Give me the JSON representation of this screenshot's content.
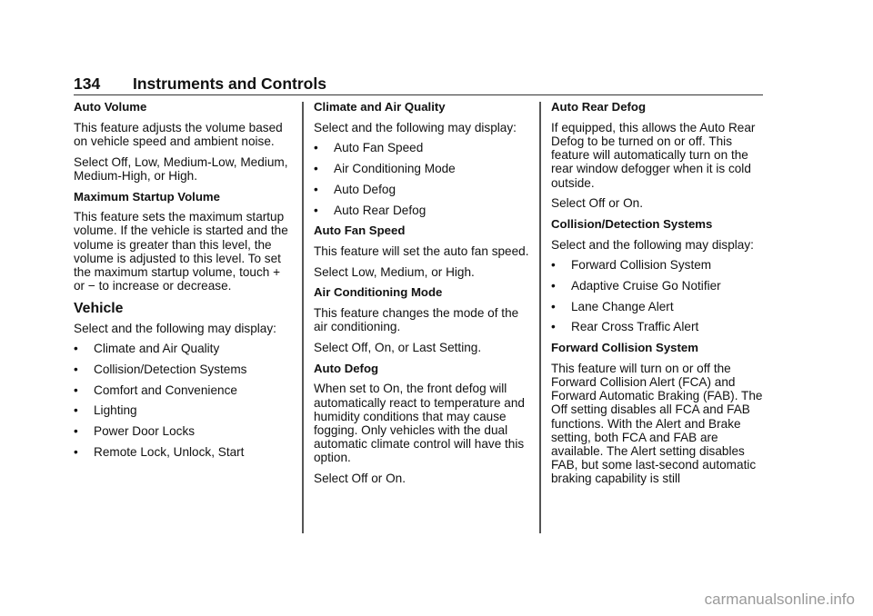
{
  "header": {
    "page_number": "134",
    "section_title": "Instruments and Controls"
  },
  "bullet_glyph": "•",
  "column1": {
    "auto_volume": {
      "heading": "Auto Volume",
      "body": "This feature adjusts the volume based on vehicle speed and ambient noise.",
      "options": "Select Off, Low, Medium-Low, Medium, Medium-High, or High."
    },
    "max_startup_volume": {
      "heading": "Maximum Startup Volume",
      "body": "This feature sets the maximum startup volume. If the vehicle is started and the volume is greater than this level, the volume is adjusted to this level. To set the maximum startup volume, touch + or − to increase or decrease."
    },
    "vehicle": {
      "heading": "Vehicle",
      "intro": "Select and the following may display:",
      "items": [
        "Climate and Air Quality",
        "Collision/Detection Systems",
        "Comfort and Convenience",
        "Lighting",
        "Power Door Locks",
        "Remote Lock, Unlock, Start"
      ]
    }
  },
  "column2": {
    "climate": {
      "heading": "Climate and Air Quality",
      "intro": "Select and the following may display:",
      "items": [
        "Auto Fan Speed",
        "Air Conditioning Mode",
        "Auto Defog",
        "Auto Rear Defog"
      ]
    },
    "auto_fan_speed": {
      "heading": "Auto Fan Speed",
      "body": "This feature will set the auto fan speed.",
      "options": "Select Low, Medium, or High."
    },
    "ac_mode": {
      "heading": "Air Conditioning Mode",
      "body": "This feature changes the mode of the air conditioning.",
      "options": "Select Off, On, or Last Setting."
    },
    "auto_defog": {
      "heading": "Auto Defog",
      "body": "When set to On, the front defog will automatically react to temperature and humidity conditions that may cause fogging. Only vehicles with the dual automatic climate control will have this option.",
      "options": "Select Off or On."
    }
  },
  "column3": {
    "auto_rear_defog": {
      "heading": "Auto Rear Defog",
      "body": "If equipped, this allows the Auto Rear Defog to be turned on or off. This feature will automatically turn on the rear window defogger when it is cold outside.",
      "options": "Select Off or On."
    },
    "collision": {
      "heading": "Collision/Detection Systems",
      "intro": "Select and the following may display:",
      "items": [
        "Forward Collision System",
        "Adaptive Cruise Go Notifier",
        "Lane Change Alert",
        "Rear Cross Traffic Alert"
      ]
    },
    "forward_collision": {
      "heading": "Forward Collision System",
      "body": "This feature will turn on or off the Forward Collision Alert (FCA) and Forward Automatic Braking (FAB). The Off setting disables all FCA and FAB functions. With the Alert and Brake setting, both FCA and FAB are available. The Alert setting disables FAB, but some last-second automatic braking capability is still"
    }
  },
  "watermark": "carmanualsonline.info"
}
